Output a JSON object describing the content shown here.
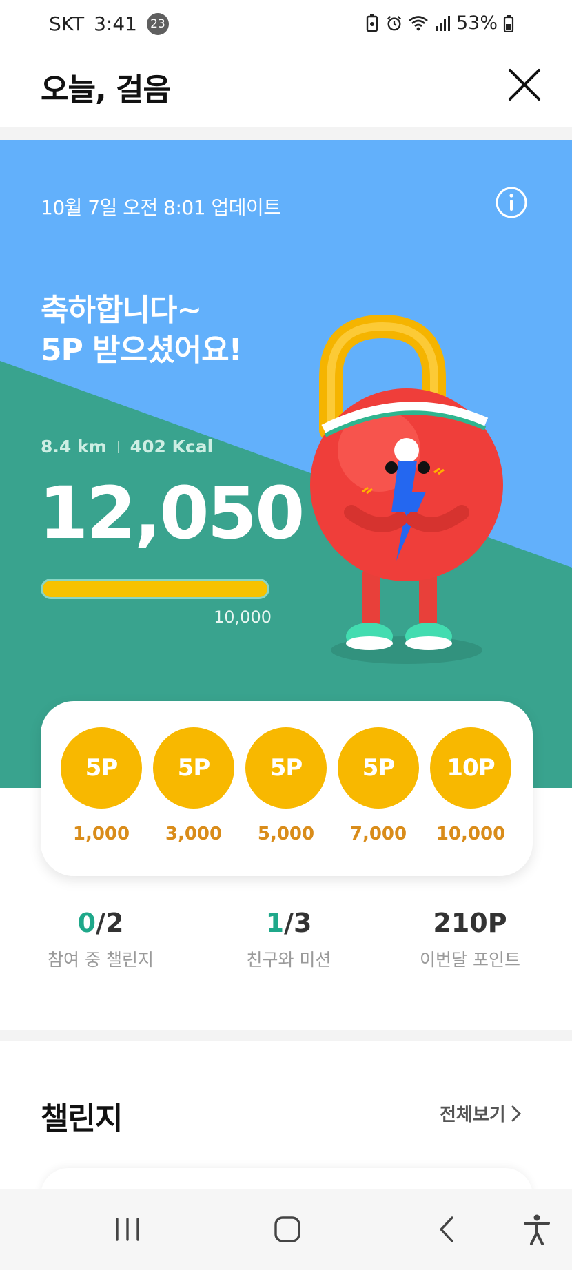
{
  "status_bar": {
    "carrier": "SKT",
    "time": "3:41",
    "notification_count": "23",
    "battery": "53%"
  },
  "header": {
    "title": "오늘, 걸음"
  },
  "hero": {
    "updated": "10월 7일 오전 8:01 업데이트",
    "congrats_line1": "축하합니다~",
    "congrats_line2": "5P 받으셨어요!",
    "distance": "8.4 km",
    "calories": "402 Kcal",
    "steps": "12,050",
    "goal": "10,000",
    "progress": 1.0,
    "colors": {
      "sky": "#62b0fb",
      "green": "#39a38e",
      "progress": "#f6c200"
    }
  },
  "milestones": [
    {
      "points": "5P",
      "steps": "1,000"
    },
    {
      "points": "5P",
      "steps": "3,000"
    },
    {
      "points": "5P",
      "steps": "5,000"
    },
    {
      "points": "5P",
      "steps": "7,000"
    },
    {
      "points": "10P",
      "steps": "10,000"
    }
  ],
  "summary": {
    "challenge_current": "0",
    "challenge_total": "/2",
    "challenge_label": "참여 중 챌린지",
    "mission_current": "1",
    "mission_total": "/3",
    "mission_label": "친구와 미션",
    "points_value": "210P",
    "points_label": "이번달 포인트"
  },
  "challenge": {
    "title": "챌린지",
    "view_all": "전체보기"
  },
  "icons": {
    "close": "close-icon",
    "info": "info-icon",
    "chevron": "chevron-right-icon",
    "nav_recents": "recents-icon",
    "nav_home": "home-icon",
    "nav_back": "back-icon",
    "nav_accessibility": "accessibility-icon"
  }
}
